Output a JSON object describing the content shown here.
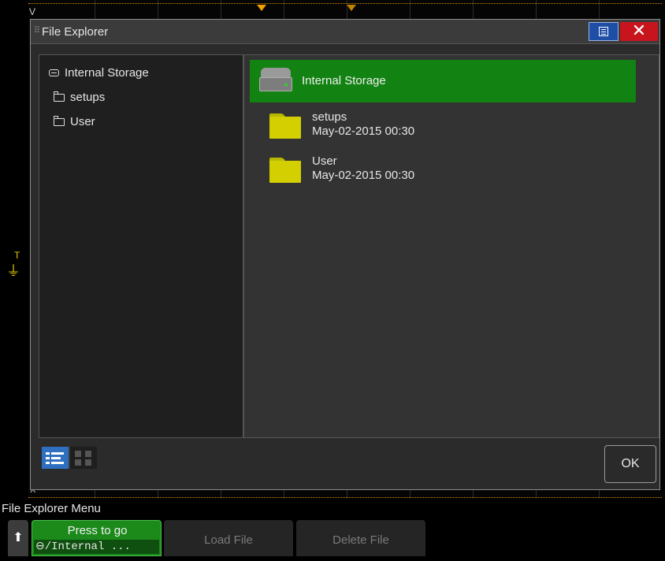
{
  "scope": {
    "vertical_marker": "V",
    "trigger_level_marker": "T",
    "time_marker": "X"
  },
  "dialog": {
    "title": "File Explorer",
    "icons": {
      "menu": "list-view-icon",
      "close": "close-icon"
    },
    "close_glyph": "✕"
  },
  "tree": {
    "items": [
      {
        "label": "Internal Storage",
        "icon": "drive-icon"
      },
      {
        "label": "setups",
        "icon": "folder-icon"
      },
      {
        "label": "User",
        "icon": "folder-icon"
      }
    ]
  },
  "contents": {
    "selected": {
      "label": "Internal Storage",
      "icon": "drive-icon"
    },
    "rows": [
      {
        "name": "setups",
        "date": "May-02-2015 00:30",
        "icon": "folder-icon"
      },
      {
        "name": "User",
        "date": "May-02-2015 00:30",
        "icon": "folder-icon"
      }
    ]
  },
  "footer": {
    "view_modes": [
      "list-view",
      "grid-view"
    ],
    "ok_label": "OK"
  },
  "softkeys": {
    "menu_title": "File Explorer Menu",
    "back_glyph": "🠕",
    "press_to_go": "Press to go",
    "path_value": "/Internal ...",
    "load_file": "Load File",
    "delete_file": "Delete File"
  },
  "colors": {
    "selected_row": "#128212",
    "folder": "#d4cf00",
    "close_button": "#c8141c",
    "menu_button": "#1f4ea6",
    "trigger": "#f0a000"
  }
}
